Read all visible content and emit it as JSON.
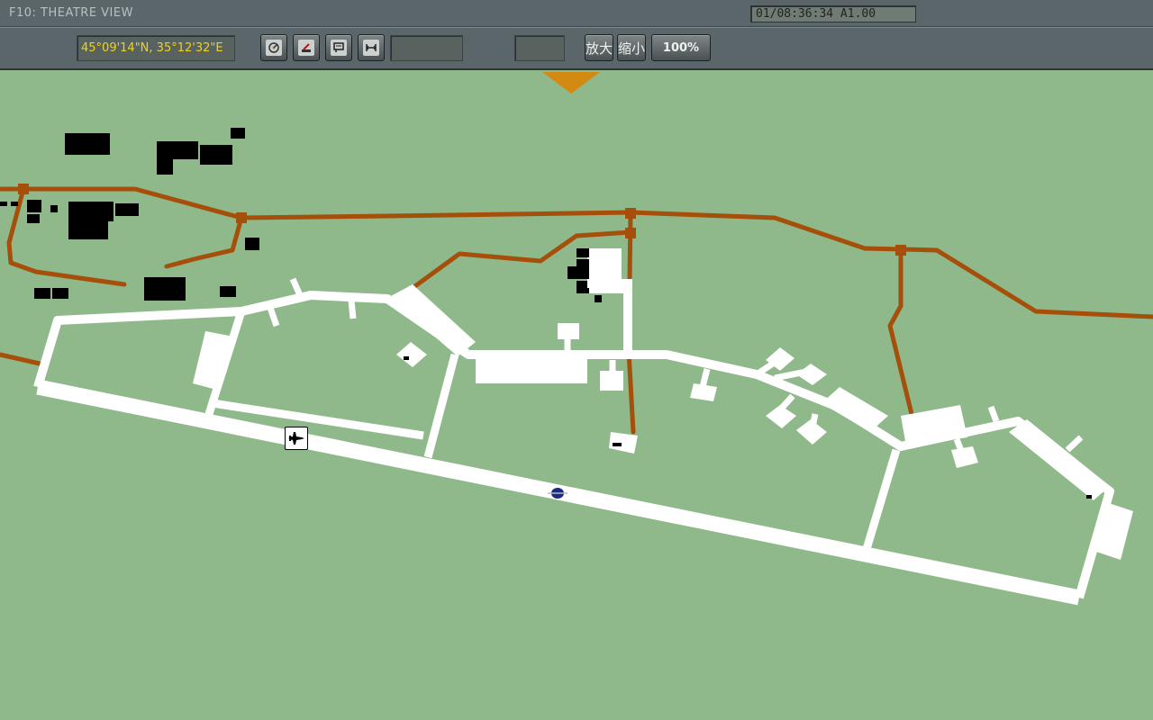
{
  "window": {
    "title": "F10: THEATRE VIEW",
    "clock": "01/08:36:34 A1.00"
  },
  "toolbar": {
    "coordinates": "45°09'14\"N, 35°12'32\"E",
    "buttons": [
      {
        "name": "radar-view-button",
        "icon": "radar-icon"
      },
      {
        "name": "sam-view-button",
        "icon": "sam-icon"
      },
      {
        "name": "comms-view-button",
        "icon": "message-icon"
      },
      {
        "name": "ruler-button",
        "icon": "ruler-icon"
      }
    ],
    "zoom_in_label": "放大",
    "zoom_out_label": "缩小",
    "zoom_level": "100%"
  },
  "map": {
    "colors": {
      "terrain": "#8fb98a",
      "road": "#a64f0a",
      "runway": "#ffffff",
      "building": "#000000",
      "north_marker": "#d38a12"
    },
    "units": [
      {
        "name": "player-aircraft",
        "icon": "fighter-jet-icon"
      },
      {
        "name": "airfield-marker",
        "icon": "airbase-icon"
      }
    ]
  }
}
